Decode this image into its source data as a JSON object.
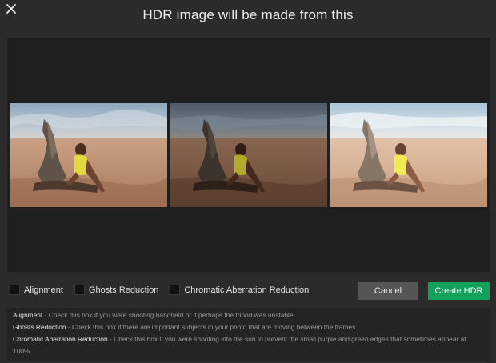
{
  "dialog": {
    "title": "HDR image will be made from this"
  },
  "preview": {
    "frames": [
      {
        "exposure": "normal"
      },
      {
        "exposure": "under"
      },
      {
        "exposure": "over"
      }
    ]
  },
  "options": [
    {
      "label": "Alignment",
      "checked": false
    },
    {
      "label": "Ghosts Reduction",
      "checked": false
    },
    {
      "label": "Chromatic Aberration Reduction",
      "checked": false
    }
  ],
  "buttons": {
    "cancel": "Cancel",
    "create": "Create HDR"
  },
  "help": [
    {
      "term": "Alignment",
      "text": " - Check this box if you were shooting handheld or if perhaps the tripod was unstable."
    },
    {
      "term": "Ghosts Reduction",
      "text": " - Check this box if there are important subjects in your photo that are moving between the frames."
    },
    {
      "term": "Chromatic Aberration Reduction",
      "text": " - Check this box if you were shooting into the sun to prevent the small purple and green edges that sometimes appear at 100%."
    }
  ],
  "colors": {
    "accent": "#11a25a",
    "cancel": "#555555",
    "background": "#2b2b2b",
    "preview_bg": "#1f1f1f"
  },
  "icons": {
    "close": "close-icon",
    "checkbox": "checkbox-icon"
  }
}
